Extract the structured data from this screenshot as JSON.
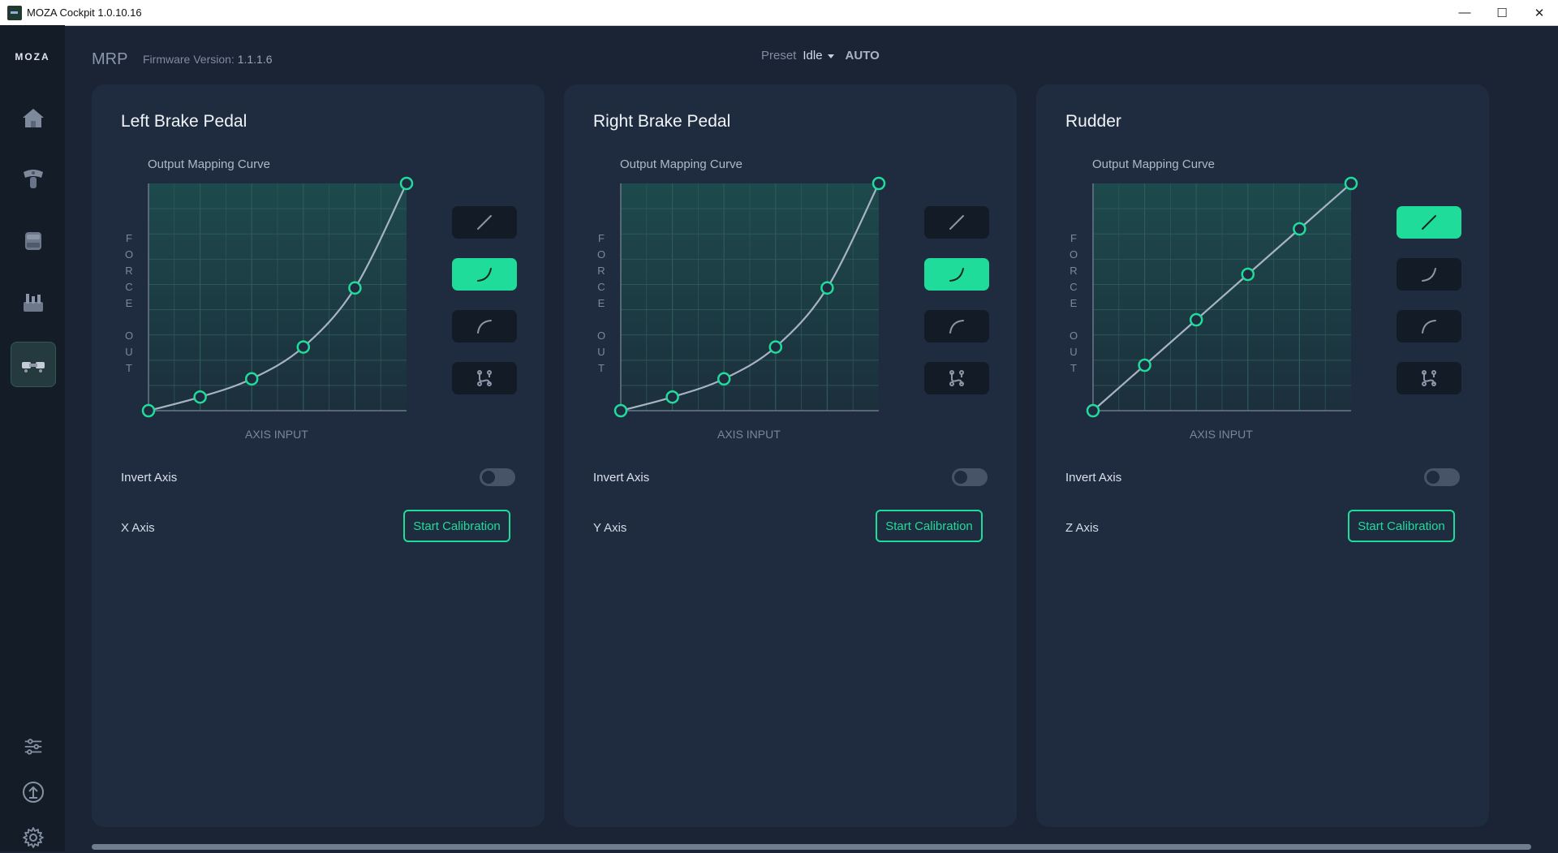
{
  "window": {
    "title": "MOZA Cockpit 1.0.10.16",
    "minimize": "—",
    "maximize": "☐",
    "close": "✕"
  },
  "sidebar": {
    "brand": "MOZA",
    "items": [
      {
        "icon": "home-icon"
      },
      {
        "icon": "joystick-icon"
      },
      {
        "icon": "throttle-icon"
      },
      {
        "icon": "switch-panel-icon"
      },
      {
        "icon": "rudder-pedals-icon",
        "active": true
      }
    ],
    "bottom": [
      {
        "icon": "sliders-icon"
      },
      {
        "icon": "upload-icon"
      },
      {
        "icon": "gear-icon"
      }
    ]
  },
  "header": {
    "device": "MRP",
    "firmware_label": "Firmware Version:",
    "firmware_value": "1.1.1.6",
    "preset_label": "Preset",
    "preset_value": "Idle",
    "auto": "AUTO"
  },
  "colors": {
    "accent": "#1fdc9a",
    "background": "#1a2434",
    "card": "#1f2c40",
    "sidebar": "#141c28"
  },
  "cards": [
    {
      "title": "Left Brake Pedal",
      "curve_label": "Output Mapping Curve",
      "y_axis": "FORCE OUT",
      "x_axis": "AXIS INPUT",
      "selected_curve": "exponential",
      "curve_points": [
        [
          0,
          0
        ],
        [
          20,
          6
        ],
        [
          40,
          14
        ],
        [
          60,
          28
        ],
        [
          80,
          54
        ],
        [
          100,
          100
        ]
      ],
      "invert_label": "Invert Axis",
      "invert_on": false,
      "axis_name": "X Axis",
      "calibration": "Start Calibration"
    },
    {
      "title": "Right Brake Pedal",
      "curve_label": "Output Mapping Curve",
      "y_axis": "FORCE OUT",
      "x_axis": "AXIS INPUT",
      "selected_curve": "exponential",
      "curve_points": [
        [
          0,
          0
        ],
        [
          20,
          6
        ],
        [
          40,
          14
        ],
        [
          60,
          28
        ],
        [
          80,
          54
        ],
        [
          100,
          100
        ]
      ],
      "invert_label": "Invert Axis",
      "invert_on": false,
      "axis_name": "Y Axis",
      "calibration": "Start Calibration"
    },
    {
      "title": "Rudder",
      "curve_label": "Output Mapping Curve",
      "y_axis": "FORCE OUT",
      "x_axis": "AXIS INPUT",
      "selected_curve": "linear",
      "curve_points": [
        [
          0,
          0
        ],
        [
          20,
          20
        ],
        [
          40,
          40
        ],
        [
          60,
          60
        ],
        [
          80,
          80
        ],
        [
          100,
          100
        ]
      ],
      "invert_label": "Invert Axis",
      "invert_on": false,
      "axis_name": "Z Axis",
      "calibration": "Start Calibration"
    }
  ],
  "curve_presets": [
    {
      "name": "linear",
      "icon": "linear-curve-icon"
    },
    {
      "name": "exponential",
      "icon": "exponential-curve-icon"
    },
    {
      "name": "logarithmic",
      "icon": "logarithmic-curve-icon"
    },
    {
      "name": "custom",
      "icon": "custom-curve-icon"
    }
  ]
}
